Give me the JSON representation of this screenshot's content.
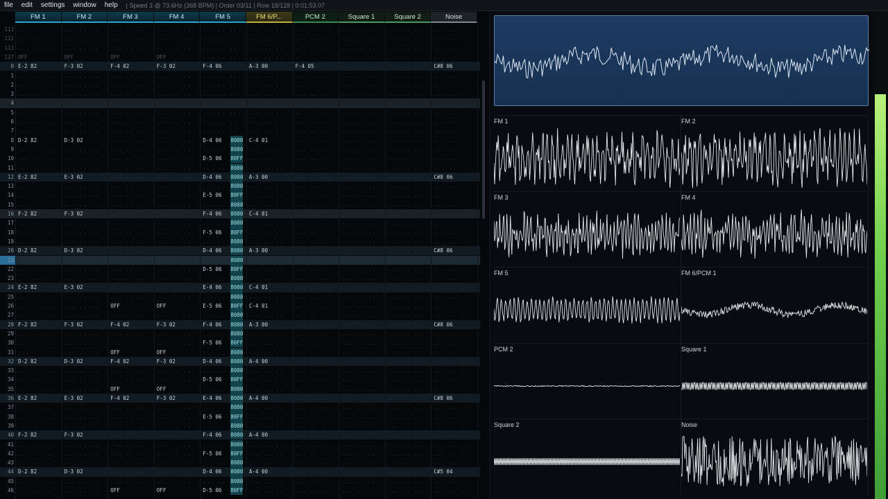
{
  "menu": [
    "file",
    "edit",
    "settings",
    "window",
    "help"
  ],
  "status_text": "| Speed 3 @ 73.6Hz (368 BPM) | Order 03/11 | Row 18/128 | 0:01:53.07",
  "channels": [
    {
      "label": "FM 1",
      "kind": "fm"
    },
    {
      "label": "FM 2",
      "kind": "fm"
    },
    {
      "label": "FM 3",
      "kind": "fm"
    },
    {
      "label": "FM 4",
      "kind": "fm"
    },
    {
      "label": "FM 5",
      "kind": "fm"
    },
    {
      "label": "FM 6/P...",
      "kind": "hot"
    },
    {
      "label": "PCM 2",
      "kind": "pcm"
    },
    {
      "label": "Square 1",
      "kind": "sq"
    },
    {
      "label": "Square 2",
      "kind": "sq"
    },
    {
      "label": "Noise",
      "kind": "noise"
    }
  ],
  "rows": [
    {
      "n": "113",
      "c": [],
      "dim": true
    },
    {
      "n": "112",
      "c": [],
      "dim": true
    },
    {
      "n": "113",
      "c": [],
      "dim": true
    },
    {
      "n": "127",
      "c": [
        [
          0,
          "OFF"
        ],
        [
          1,
          "OFF"
        ],
        [
          2,
          "OFF"
        ],
        [
          3,
          "OFF"
        ]
      ],
      "dim": true
    },
    {
      "n": "0",
      "c": [
        [
          0,
          "E-2 82"
        ],
        [
          1,
          "F-3 02"
        ],
        [
          2,
          "F-4 02"
        ],
        [
          3,
          "F-3 02"
        ],
        [
          4,
          "F-4 06"
        ],
        [
          5,
          "A-3 00"
        ],
        [
          6,
          "F-4 05"
        ],
        [
          9,
          "C#8 06"
        ]
      ],
      "hl": 1
    },
    {
      "n": "1",
      "c": []
    },
    {
      "n": "2",
      "c": []
    },
    {
      "n": "3",
      "c": []
    },
    {
      "n": "4",
      "c": [],
      "hl": 2
    },
    {
      "n": "5",
      "c": []
    },
    {
      "n": "6",
      "c": []
    },
    {
      "n": "7",
      "c": []
    },
    {
      "n": "8",
      "c": [
        [
          0,
          "D-2 82"
        ],
        [
          1,
          "D-3 02"
        ],
        [
          4,
          "D-4 06"
        ],
        [
          5,
          "C-4 01"
        ]
      ],
      "t": "8080"
    },
    {
      "n": "9",
      "c": [],
      "t": "8080"
    },
    {
      "n": "10",
      "c": [
        [
          4,
          "D-5 06"
        ]
      ],
      "t": "80FF"
    },
    {
      "n": "11",
      "c": [],
      "t": "8080"
    },
    {
      "n": "12",
      "c": [
        [
          0,
          "E-2 82"
        ],
        [
          1,
          "E-3 02"
        ],
        [
          4,
          "D-4 06"
        ],
        [
          5,
          "A-3 00"
        ],
        [
          9,
          "C#8 06"
        ]
      ],
      "t": "8080",
      "hl": 1
    },
    {
      "n": "13",
      "c": [],
      "t": "8080"
    },
    {
      "n": "14",
      "c": [
        [
          4,
          "E-5 06"
        ]
      ],
      "t": "80FF"
    },
    {
      "n": "15",
      "c": [],
      "t": "8080"
    },
    {
      "n": "16",
      "c": [
        [
          0,
          "F-2 82"
        ],
        [
          1,
          "F-3 02"
        ],
        [
          4,
          "F-4 06"
        ],
        [
          5,
          "C-4 01"
        ]
      ],
      "t": "8080",
      "hl": 2
    },
    {
      "n": "17",
      "c": [],
      "t": "8080"
    },
    {
      "n": "18",
      "c": [
        [
          4,
          "F-5 06"
        ]
      ],
      "t": "80FF"
    },
    {
      "n": "19",
      "c": [],
      "t": "8080"
    },
    {
      "n": "20",
      "c": [
        [
          0,
          "D-2 82"
        ],
        [
          1,
          "D-3 02"
        ],
        [
          4,
          "D-4 06"
        ],
        [
          5,
          "A-3 00"
        ],
        [
          9,
          "C#8 06"
        ]
      ],
      "t": "8080",
      "hl": 1
    },
    {
      "n": "21",
      "c": [],
      "t": "8080",
      "cur": true
    },
    {
      "n": "22",
      "c": [
        [
          4,
          "D-5 06"
        ]
      ],
      "t": "80FF"
    },
    {
      "n": "23",
      "c": [],
      "t": "8080"
    },
    {
      "n": "24",
      "c": [
        [
          0,
          "E-2 82"
        ],
        [
          1,
          "E-3 02"
        ],
        [
          4,
          "E-4 06"
        ],
        [
          5,
          "C-4 01"
        ]
      ],
      "t": "8080",
      "hl": 1
    },
    {
      "n": "25",
      "c": [],
      "t": "8080"
    },
    {
      "n": "26",
      "c": [
        [
          2,
          "OFF"
        ],
        [
          3,
          "OFF"
        ],
        [
          4,
          "E-5 06"
        ],
        [
          5,
          "C-4 01"
        ]
      ],
      "t": "80FF"
    },
    {
      "n": "27",
      "c": [],
      "t": "8080"
    },
    {
      "n": "28",
      "c": [
        [
          0,
          "F-2 82"
        ],
        [
          1,
          "F-3 02"
        ],
        [
          2,
          "F-4 02"
        ],
        [
          3,
          "F-3 02"
        ],
        [
          4,
          "F-4 06"
        ],
        [
          5,
          "A-3 00"
        ],
        [
          9,
          "C#8 06"
        ]
      ],
      "t": "8080",
      "hl": 1
    },
    {
      "n": "29",
      "c": [],
      "t": "8080"
    },
    {
      "n": "30",
      "c": [
        [
          4,
          "F-5 06"
        ]
      ],
      "t": "80FF"
    },
    {
      "n": "31",
      "c": [
        [
          2,
          "OFF"
        ],
        [
          3,
          "OFF"
        ]
      ],
      "t": "8080"
    },
    {
      "n": "32",
      "c": [
        [
          0,
          "D-2 82"
        ],
        [
          1,
          "D-3 02"
        ],
        [
          2,
          "F-4 02"
        ],
        [
          3,
          "F-3 02"
        ],
        [
          4,
          "D-4 06"
        ],
        [
          5,
          "A-4 00"
        ]
      ],
      "t": "8080",
      "hl": 1
    },
    {
      "n": "33",
      "c": [],
      "t": "8080"
    },
    {
      "n": "34",
      "c": [
        [
          4,
          "D-5 06"
        ]
      ],
      "t": "80FF"
    },
    {
      "n": "35",
      "c": [
        [
          2,
          "OFF"
        ],
        [
          3,
          "OFF"
        ]
      ],
      "t": "8080"
    },
    {
      "n": "36",
      "c": [
        [
          0,
          "E-2 82"
        ],
        [
          1,
          "E-3 02"
        ],
        [
          2,
          "F-4 02"
        ],
        [
          3,
          "F-3 02"
        ],
        [
          4,
          "E-4 06"
        ],
        [
          5,
          "A-4 00"
        ],
        [
          9,
          "C#8 06"
        ]
      ],
      "t": "8080",
      "hl": 1
    },
    {
      "n": "37",
      "c": [],
      "t": "8080"
    },
    {
      "n": "38",
      "c": [
        [
          4,
          "E-5 06"
        ]
      ],
      "t": "80FF"
    },
    {
      "n": "39",
      "c": [],
      "t": "8080"
    },
    {
      "n": "40",
      "c": [
        [
          0,
          "F-2 82"
        ],
        [
          1,
          "F-3 02"
        ],
        [
          4,
          "F-4 06"
        ],
        [
          5,
          "A-4 00"
        ]
      ],
      "t": "8080",
      "hl": 1
    },
    {
      "n": "41",
      "c": [],
      "t": "8080"
    },
    {
      "n": "42",
      "c": [
        [
          4,
          "F-5 06"
        ]
      ],
      "t": "80FF"
    },
    {
      "n": "43",
      "c": [],
      "t": "8080"
    },
    {
      "n": "44",
      "c": [
        [
          0,
          "D-2 82"
        ],
        [
          1,
          "D-3 02"
        ],
        [
          4,
          "D-4 06"
        ],
        [
          5,
          "A-4 00"
        ],
        [
          9,
          "C#5 04"
        ]
      ],
      "t": "8080",
      "hl": 1
    },
    {
      "n": "45",
      "c": [],
      "t": "8080"
    },
    {
      "n": "46",
      "c": [
        [
          2,
          "OFF"
        ],
        [
          3,
          "OFF"
        ],
        [
          4,
          "D-5 06"
        ]
      ],
      "t": "80FF"
    }
  ],
  "oscilloscopes": [
    {
      "label": "FM 1",
      "style": "dense"
    },
    {
      "label": "FM 2",
      "style": "dense"
    },
    {
      "label": "FM 3",
      "style": "noisy"
    },
    {
      "label": "FM 4",
      "style": "noisy"
    },
    {
      "label": "FM 5",
      "style": "wave"
    },
    {
      "label": "FM 6/PCM 1",
      "style": "soft"
    },
    {
      "label": "PCM 2",
      "style": "flat"
    },
    {
      "label": "Square 1",
      "style": "square"
    },
    {
      "label": "Square 2",
      "style": "square-fine"
    },
    {
      "label": "Noise",
      "style": "noise"
    }
  ],
  "meter_level": 0.83
}
